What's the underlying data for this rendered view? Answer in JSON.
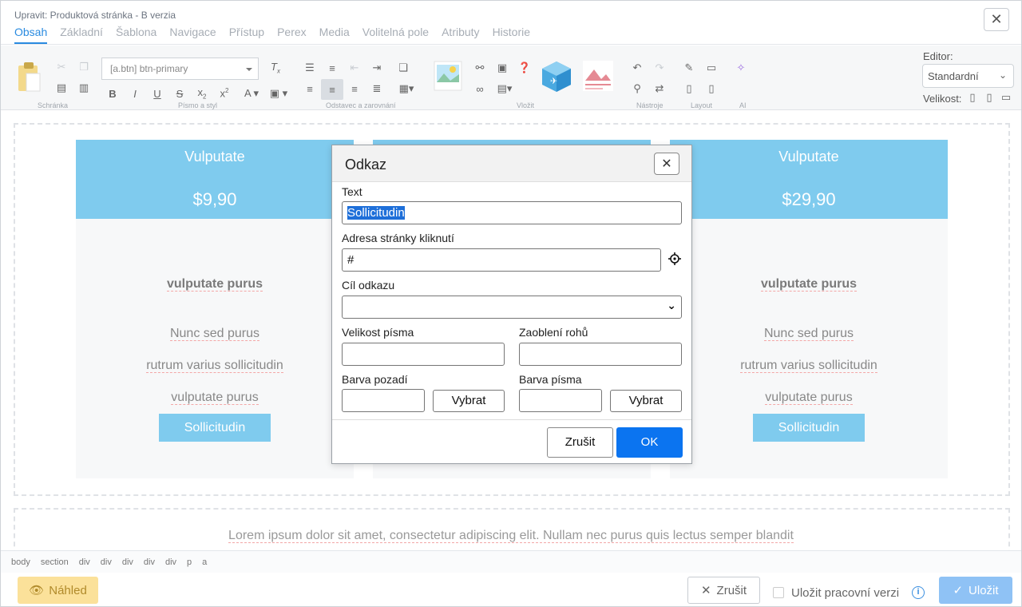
{
  "window": {
    "title": "Upravit: Produktová stránka - B verzia",
    "tabs": [
      {
        "label": "Obsah"
      },
      {
        "label": "Základní"
      },
      {
        "label": "Šablona"
      },
      {
        "label": "Navigace"
      },
      {
        "label": "Přístup"
      },
      {
        "label": "Perex"
      },
      {
        "label": "Media"
      },
      {
        "label": "Volitelná pole"
      },
      {
        "label": "Atributy"
      },
      {
        "label": "Historie"
      }
    ],
    "active_tab": "Obsah"
  },
  "toolbar": {
    "style_select_value": "[a.btn] btn-primary",
    "groups": {
      "clipboard": "Schránka",
      "font": "Písmo a styl",
      "paragraph": "Odstavec a zarovnání",
      "insert": "Vložit",
      "tools": "Nástroje",
      "layout": "Layout",
      "ai": "AI"
    },
    "editor_label": "Editor:",
    "editor_value": "Standardní",
    "size_label": "Velikost:"
  },
  "cards": [
    {
      "name": "Vulputate",
      "price": "$9,90",
      "feature_title": "vulputate purus",
      "features": [
        "Nunc sed purus",
        "rutrum varius sollicitudin",
        "vulputate purus"
      ],
      "button": "Sollicitudin"
    },
    {
      "name": "Vulputate",
      "price": "$29,90",
      "feature_title": "vulputate purus",
      "features": [
        "Nunc sed purus",
        "rutrum varius sollicitudin",
        "vulputate purus"
      ],
      "button": "Sollicitudin"
    }
  ],
  "lorem": "Lorem ipsum dolor sit amet, consectetur adipiscing elit. Nullam nec purus quis lectus semper blandit",
  "path": [
    "body",
    "section",
    "div",
    "div",
    "div",
    "div",
    "div",
    "p",
    "a"
  ],
  "footer": {
    "preview": "Náhled",
    "cancel": "Zrušit",
    "save_draft": "Uložit pracovní verzi",
    "save": "Uložit"
  },
  "dialog": {
    "title": "Odkaz",
    "text_label": "Text",
    "text_value": "Sollicitudin",
    "url_label": "Adresa stránky kliknutí",
    "url_value": "#",
    "target_label": "Cíl odkazu",
    "target_value": "",
    "font_size_label": "Velikost písma",
    "font_size_value": "",
    "radius_label": "Zaoblení rohů",
    "radius_value": "",
    "bg_color_label": "Barva pozadí",
    "bg_color_value": "",
    "font_color_label": "Barva písma",
    "font_color_value": "",
    "pick_label": "Vybrat",
    "cancel": "Zrušit",
    "ok": "OK"
  },
  "colors": {
    "accent": "#2a8be0",
    "card_header": "#7fcbee",
    "ok_button": "#0b74f0",
    "preview_button": "#fbe19a",
    "save_button": "#8fc2f5"
  }
}
